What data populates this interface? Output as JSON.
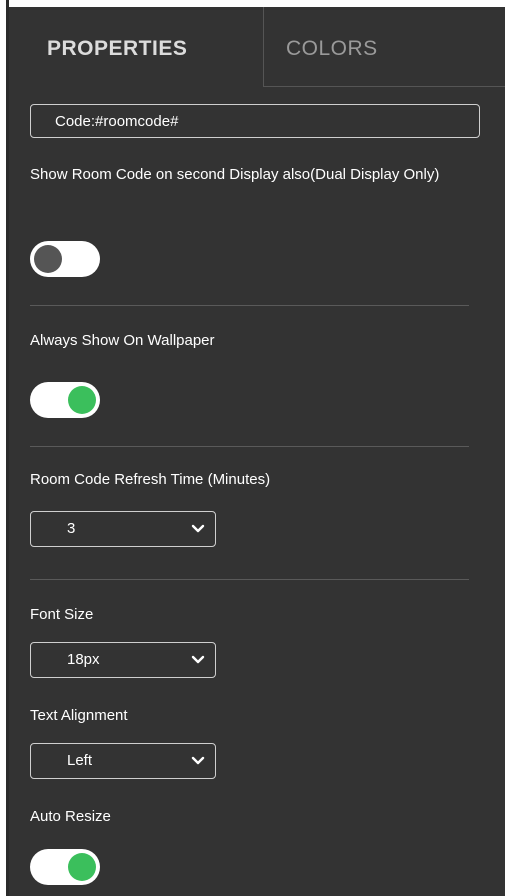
{
  "tabs": [
    {
      "label": "PROPERTIES",
      "active": true
    },
    {
      "label": "COLORS",
      "active": false
    }
  ],
  "room_code_field": {
    "value": "Code:#roomcode#"
  },
  "dual_display": {
    "label": "Show Room Code on second Display also(Dual Display Only)",
    "enabled": false
  },
  "wallpaper": {
    "label": "Always Show On Wallpaper",
    "enabled": true
  },
  "refresh_time": {
    "label": "Room Code Refresh Time (Minutes)",
    "selected": "3"
  },
  "font_size": {
    "label": "Font Size",
    "selected": "18px"
  },
  "text_alignment": {
    "label": "Text Alignment",
    "selected": "Left"
  },
  "auto_resize": {
    "label": "Auto Resize",
    "enabled": true
  },
  "colors": {
    "panel_bg": "#333333",
    "toggle_on": "#3bbf5c",
    "toggle_off_knob": "#555555",
    "toggle_track": "#ffffff"
  },
  "icons": {
    "dropdown": "chevron-down-icon"
  }
}
